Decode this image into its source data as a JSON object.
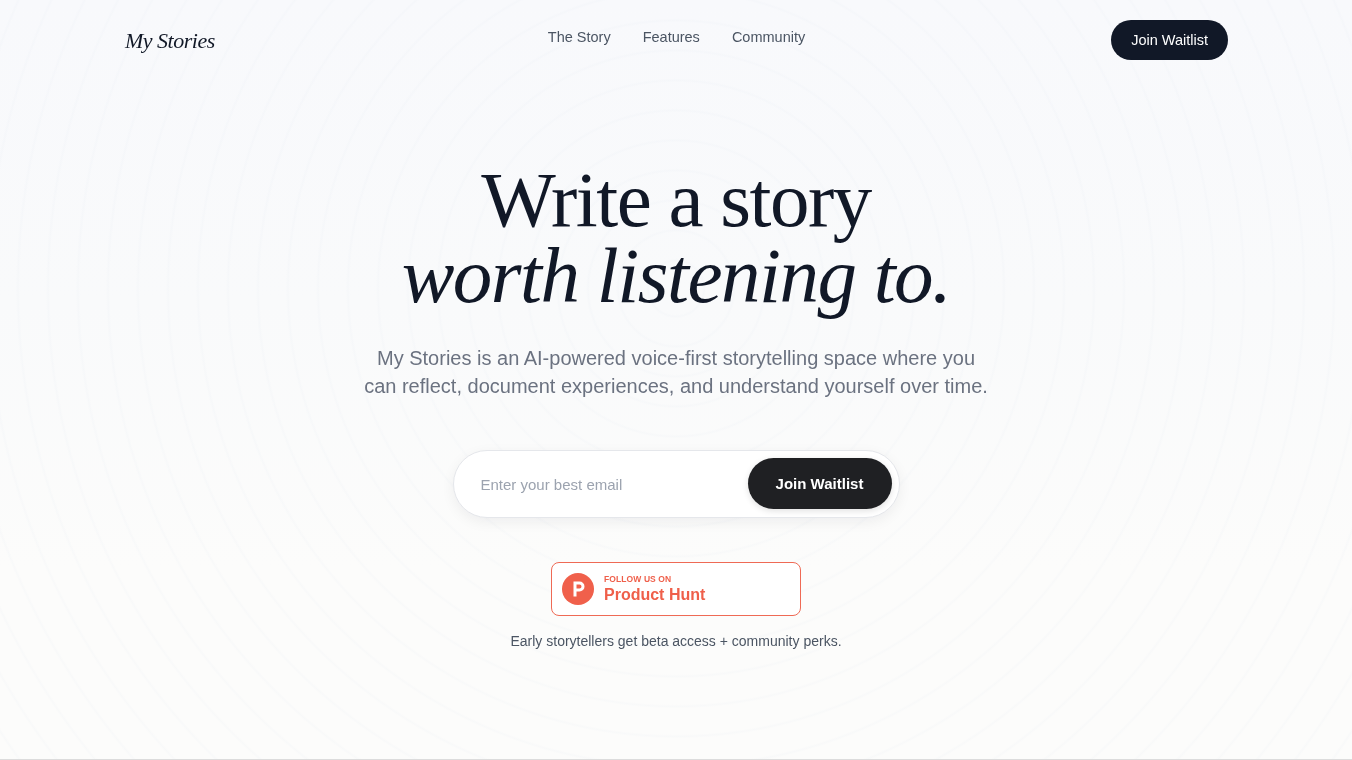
{
  "nav": {
    "logo": "My Stories",
    "links": [
      {
        "label": "The Story"
      },
      {
        "label": "Features"
      },
      {
        "label": "Community"
      }
    ],
    "cta": "Join Waitlist"
  },
  "hero": {
    "headline": [
      {
        "text": "Write a story",
        "italic": false
      },
      {
        "text": "worth listening to.",
        "italic": true
      }
    ],
    "subtitle": "My Stories is an AI-powered voice-first storytelling space where you can reflect, document experiences, and understand yourself over time.",
    "signup": {
      "placeholder": "Enter your best email",
      "button": "Join Waitlist"
    },
    "badge": {
      "kicker": "FOLLOW US ON",
      "title": "Product Hunt"
    },
    "note": "Early storytellers get beta access + community perks."
  }
}
